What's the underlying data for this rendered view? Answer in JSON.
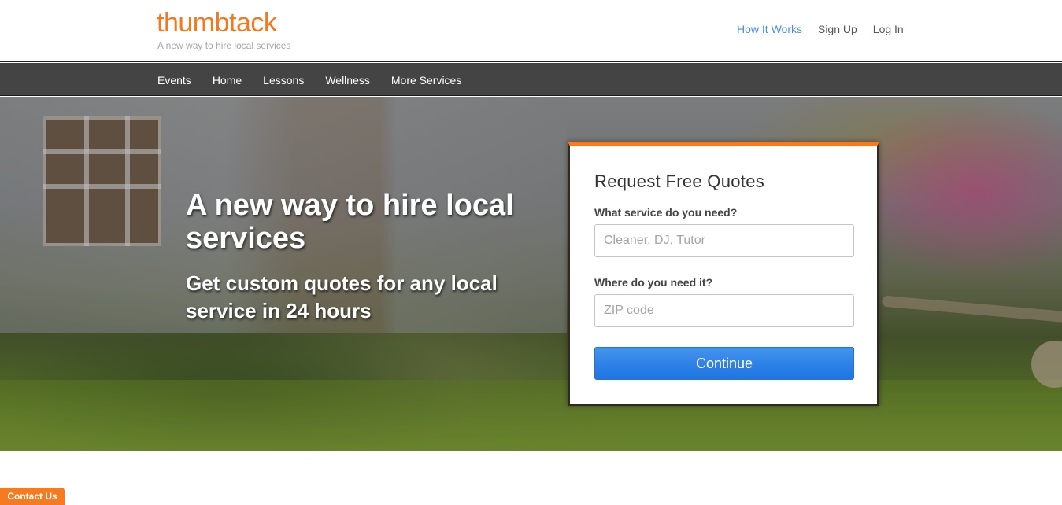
{
  "brand": {
    "logo_text": "thumbtack",
    "tagline": "A new way to hire local services",
    "accent_color": "#f47b20",
    "link_color": "#4a8fdc",
    "button_color": "#2b7fe6"
  },
  "top_nav": {
    "items": [
      {
        "label": "How It Works",
        "active": true
      },
      {
        "label": "Sign Up",
        "active": false
      },
      {
        "label": "Log In",
        "active": false
      }
    ]
  },
  "category_nav": {
    "items": [
      {
        "label": "Events"
      },
      {
        "label": "Home"
      },
      {
        "label": "Lessons"
      },
      {
        "label": "Wellness"
      },
      {
        "label": "More Services"
      }
    ]
  },
  "hero": {
    "title": "A new way to hire local services",
    "subtitle": "Get custom quotes for any local service in 24 hours"
  },
  "quote_form": {
    "title": "Request Free Quotes",
    "service_label": "What service do you need?",
    "service_placeholder": "Cleaner, DJ, Tutor",
    "service_value": "",
    "location_label": "Where do you need it?",
    "location_placeholder": "ZIP code",
    "location_value": "",
    "submit_label": "Continue"
  },
  "contact_tab": {
    "label": "Contact Us"
  }
}
